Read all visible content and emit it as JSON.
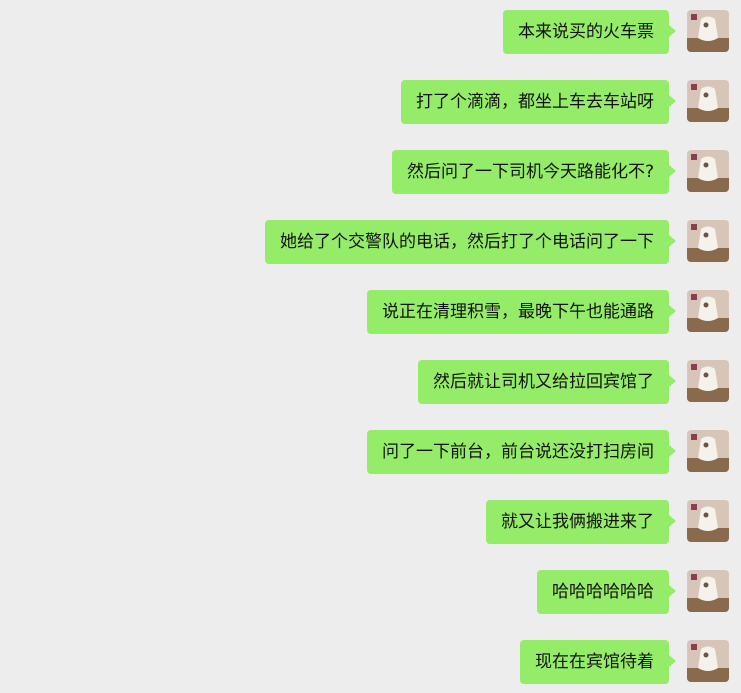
{
  "chat": {
    "messages": [
      {
        "text": "本来说买的火车票"
      },
      {
        "text": "打了个滴滴，都坐上车去车站呀"
      },
      {
        "text": "然后问了一下司机今天路能化不?"
      },
      {
        "text": "她给了个交警队的电话，然后打了个电话问了一下"
      },
      {
        "text": "说正在清理积雪，最晚下午也能通路"
      },
      {
        "text": "然后就让司机又给拉回宾馆了"
      },
      {
        "text": "问了一下前台，前台说还没打扫房间"
      },
      {
        "text": "就又让我俩搬进来了"
      },
      {
        "text": "哈哈哈哈哈哈"
      },
      {
        "text": "现在在宾馆待着"
      }
    ]
  },
  "colors": {
    "background": "#ededed",
    "bubble": "#95ec69",
    "text": "#111111"
  },
  "icons": {
    "avatar": "user-avatar-icon"
  }
}
